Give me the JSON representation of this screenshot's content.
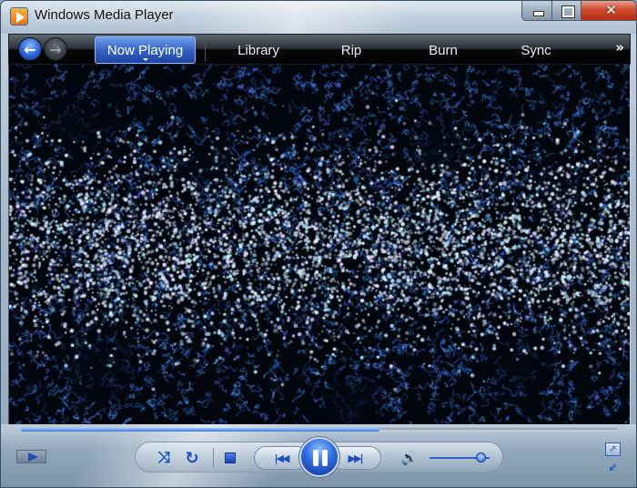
{
  "window": {
    "title": "Windows Media Player",
    "icon": "media-player-icon",
    "caption_buttons": {
      "minimize_icon": "minimize-icon",
      "maximize_icon": "maximize-icon",
      "close_icon": "close-icon",
      "close_glyph": "✕"
    }
  },
  "nav": {
    "back_glyph": "←",
    "forward_glyph": "→",
    "tabs": [
      {
        "label": "Now Playing",
        "active": true
      },
      {
        "label": "Library",
        "active": false
      },
      {
        "label": "Rip",
        "active": false
      },
      {
        "label": "Burn",
        "active": false
      },
      {
        "label": "Sync",
        "active": false
      }
    ],
    "more_glyph": "»"
  },
  "visualization": {
    "description": "Blue particle visualization",
    "colors": {
      "background": "#02060d",
      "primary": "#2f7fff",
      "light": "#bfe0ff"
    }
  },
  "playback": {
    "seek_progress_percent": 60,
    "volume_percent": 85,
    "state": "playing",
    "icons": {
      "shuffle": "⤨",
      "repeat": "↻",
      "prev": "|◀◀",
      "next": "▶▶|",
      "speaker": "🔊",
      "switch_view": "⇗",
      "compact": "⇙"
    }
  },
  "colors": {
    "accent": "#2d62d8",
    "close_button": "#c83a1c"
  }
}
